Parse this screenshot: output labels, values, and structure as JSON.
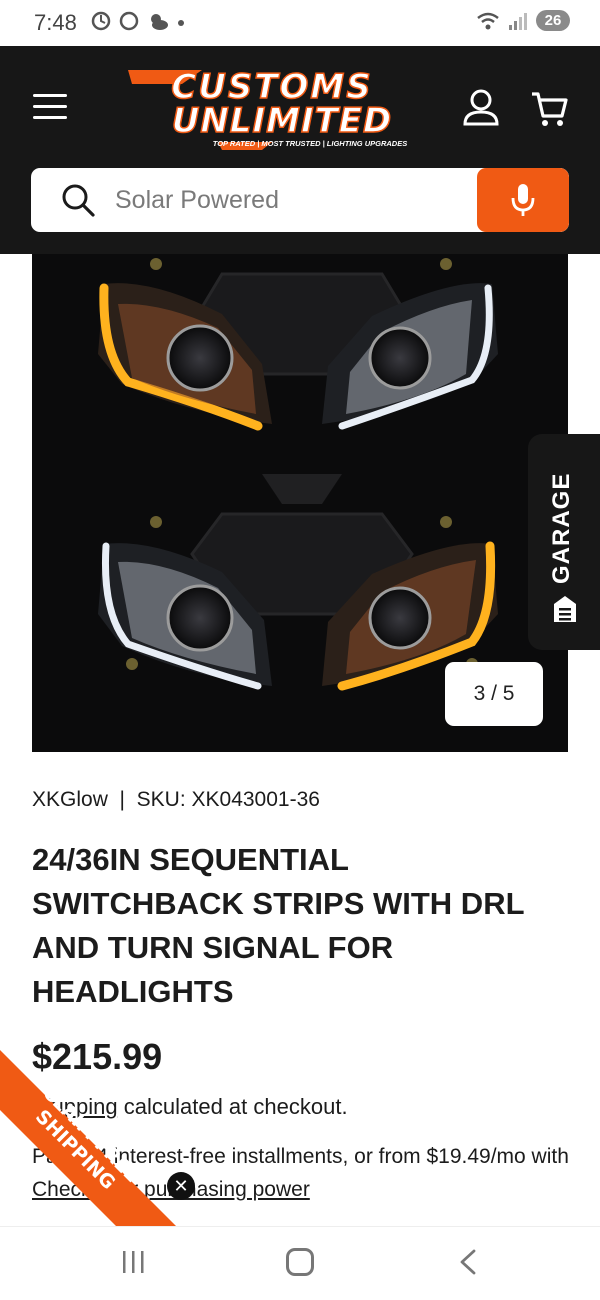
{
  "status_bar": {
    "time": "7:48",
    "battery": "26"
  },
  "header": {
    "logo": {
      "line1": "CUSTOMS",
      "line2": "UNLIMITED",
      "tagline": "TOP RATED | MOST TRUSTED | LIGHTING UPGRADES"
    },
    "search": {
      "placeholder": "Solar Powered"
    }
  },
  "gallery": {
    "counter": "3 / 5"
  },
  "garage_tab": {
    "label": "GARAGE"
  },
  "product": {
    "vendor_sku": "XKGlow  |  SKU: XK043001-36",
    "title": "24/36IN SEQUENTIAL SWITCHBACK STRIPS WITH DRL AND TURN SIGNAL FOR HEADLIGHTS",
    "price": "$215.99",
    "shipping_link": "Shipping",
    "shipping_rest": " calculated at checkout.",
    "installments_text": "Pay in 4 interest-free installments, or from $19.49/mo with",
    "installments_link": "Check your purchasing power"
  },
  "promo_ribbon": {
    "text": "CLAIM FREE SHIPPING",
    "close": "✕",
    "color": "#f05a14"
  },
  "colors": {
    "brand_orange": "#f05a14",
    "header_bg": "#171717"
  }
}
